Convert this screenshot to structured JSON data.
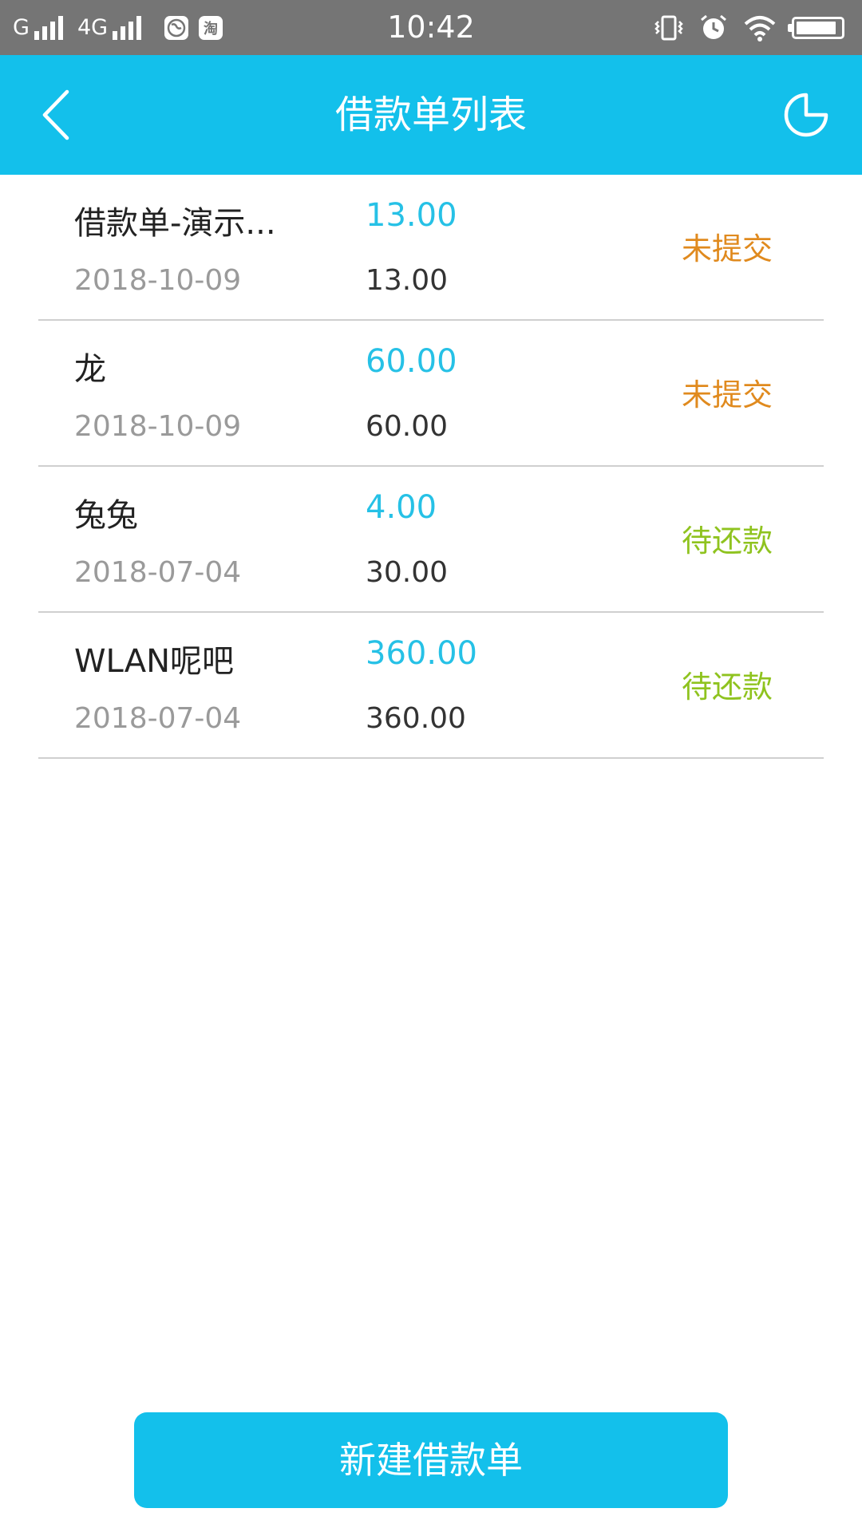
{
  "status_bar": {
    "network_1": "G",
    "network_2": "4G",
    "app_icon_label": "淘",
    "time": "10:42",
    "battery_level": 0.9
  },
  "header": {
    "title": "借款单列表"
  },
  "loans": [
    {
      "name": "借款单-演示...",
      "amount": "13.00",
      "date": "2018-10-09",
      "total": "13.00",
      "status": "未提交",
      "status_color": "#e08a1e"
    },
    {
      "name": "龙",
      "amount": "60.00",
      "date": "2018-10-09",
      "total": "60.00",
      "status": "未提交",
      "status_color": "#e08a1e"
    },
    {
      "name": "兔兔",
      "amount": "4.00",
      "date": "2018-07-04",
      "total": "30.00",
      "status": "待还款",
      "status_color": "#8fc31f"
    },
    {
      "name": "WLAN呢吧",
      "amount": "360.00",
      "date": "2018-07-04",
      "total": "360.00",
      "status": "待还款",
      "status_color": "#8fc31f"
    }
  ],
  "footer": {
    "new_button_label": "新建借款单"
  },
  "colors": {
    "primary": "#13c0eb",
    "amount": "#26c1e6",
    "pending": "#e08a1e",
    "repay": "#8fc31f"
  },
  "icons": {
    "back": "chevron-left-icon",
    "chart": "pie-chart-icon"
  }
}
